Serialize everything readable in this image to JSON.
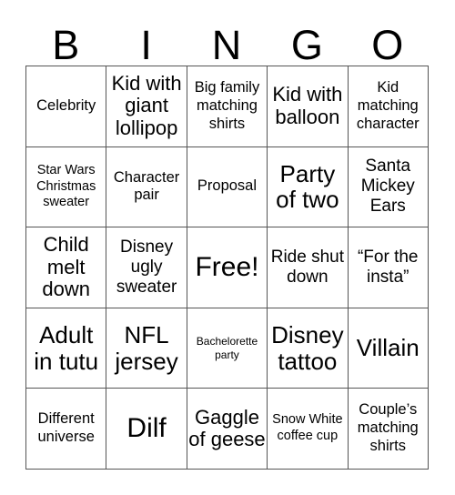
{
  "card": {
    "header_letters": [
      "B",
      "I",
      "N",
      "G",
      "O"
    ],
    "grid": {
      "columns": 5,
      "rows": 5,
      "border_color": "#555555",
      "background_color": "#ffffff",
      "text_color": "#000000"
    },
    "cells": [
      [
        {
          "text": "Celebrity",
          "size": "md"
        },
        {
          "text": "Kid with giant lollipop",
          "size": "xl"
        },
        {
          "text": "Big family matching shirts",
          "size": "md"
        },
        {
          "text": "Kid with balloon",
          "size": "xl"
        },
        {
          "text": "Kid matching character",
          "size": "md"
        }
      ],
      [
        {
          "text": "Star Wars Christmas sweater",
          "size": "sm"
        },
        {
          "text": "Character pair",
          "size": "md"
        },
        {
          "text": "Proposal",
          "size": "md"
        },
        {
          "text": "Party of two",
          "size": "xxl"
        },
        {
          "text": "Santa Mickey Ears",
          "size": "lg"
        }
      ],
      [
        {
          "text": "Child melt down",
          "size": "xl"
        },
        {
          "text": "Disney ugly sweater",
          "size": "lg"
        },
        {
          "text": "Free!",
          "size": "huge"
        },
        {
          "text": "Ride shut down",
          "size": "lg"
        },
        {
          "text": "“For the insta”",
          "size": "lg"
        }
      ],
      [
        {
          "text": "Adult in tutu",
          "size": "xxl"
        },
        {
          "text": "NFL jersey",
          "size": "xxl"
        },
        {
          "text": "Bachelorette party",
          "size": "xs"
        },
        {
          "text": "Disney tattoo",
          "size": "xxl"
        },
        {
          "text": "Villain",
          "size": "xxl"
        }
      ],
      [
        {
          "text": "Different universe",
          "size": "md"
        },
        {
          "text": "Dilf",
          "size": "huge"
        },
        {
          "text": "Gaggle of geese",
          "size": "xl"
        },
        {
          "text": "Snow White coffee cup",
          "size": "sm"
        },
        {
          "text": "Couple’s matching shirts",
          "size": "md"
        }
      ]
    ]
  }
}
